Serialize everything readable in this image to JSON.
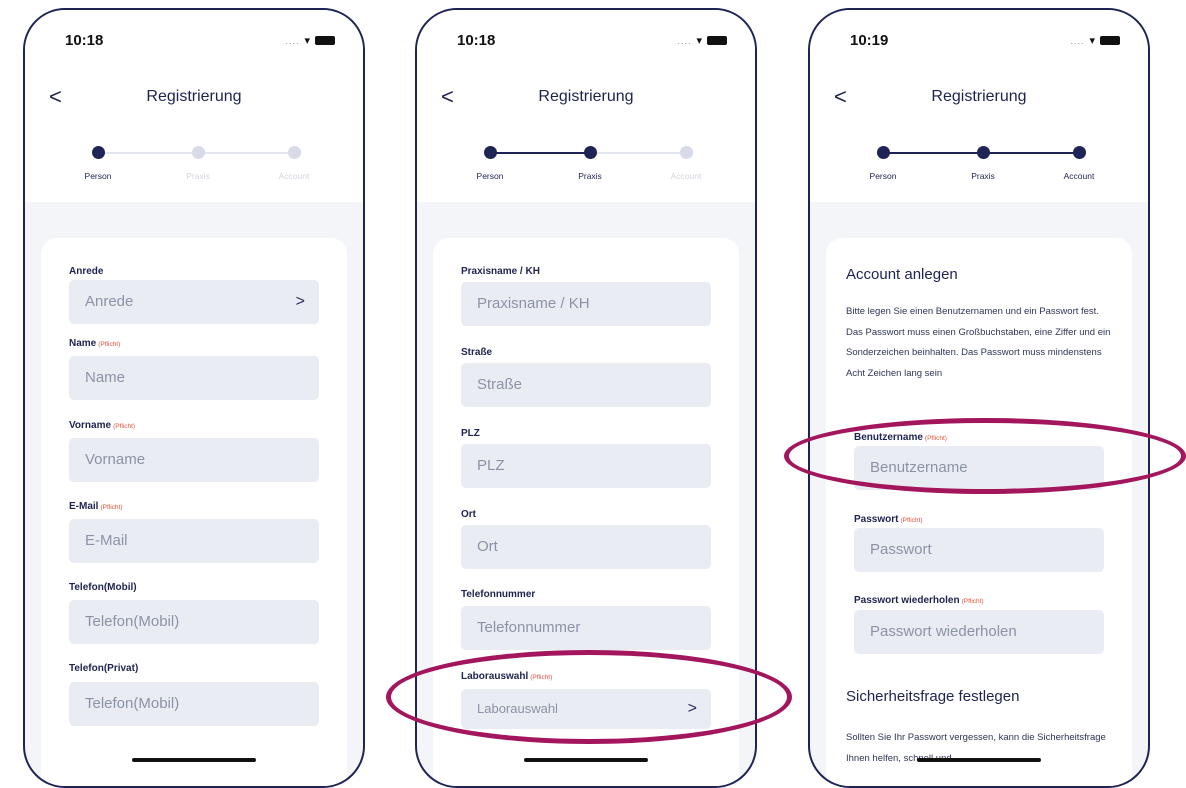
{
  "colors": {
    "primary": "#1f2456",
    "highlight": "#a3155c",
    "required": "#e0533b",
    "input_bg": "#e9ecf3"
  },
  "status": {
    "dots": "....",
    "wifi_icon": "wifi-icon",
    "battery_icon": "battery-icon"
  },
  "screens": [
    {
      "time": "10:18",
      "title": "Registrierung",
      "back": "<",
      "steps": [
        {
          "label": "Person",
          "state": "active"
        },
        {
          "label": "Praxis",
          "state": "inactive"
        },
        {
          "label": "Account",
          "state": "inactive"
        }
      ],
      "fields": [
        {
          "label": "Anrede",
          "required": "",
          "placeholder": "Anrede",
          "chevron": ">"
        },
        {
          "label": "Name",
          "required": "(Pflicht)",
          "placeholder": "Name"
        },
        {
          "label": "Vorname",
          "required": "(Pflicht)",
          "placeholder": "Vorname"
        },
        {
          "label": "E-Mail",
          "required": "(Pflicht)",
          "placeholder": "E-Mail"
        },
        {
          "label": "Telefon(Mobil)",
          "required": "",
          "placeholder": "Telefon(Mobil)"
        },
        {
          "label": "Telefon(Privat)",
          "required": "",
          "placeholder": "Telefon(Mobil)"
        }
      ]
    },
    {
      "time": "10:18",
      "title": "Registrierung",
      "back": "<",
      "steps": [
        {
          "label": "Person",
          "state": "active"
        },
        {
          "label": "Praxis",
          "state": "active"
        },
        {
          "label": "Account",
          "state": "inactive"
        }
      ],
      "fields": [
        {
          "label": "Praxisname / KH",
          "required": "",
          "placeholder": "Praxisname / KH"
        },
        {
          "label": "Straße",
          "required": "",
          "placeholder": "Straße"
        },
        {
          "label": "PLZ",
          "required": "",
          "placeholder": "PLZ"
        },
        {
          "label": "Ort",
          "required": "",
          "placeholder": "Ort"
        },
        {
          "label": "Telefonnummer",
          "required": "",
          "placeholder": "Telefonnummer"
        },
        {
          "label": "Laborauswahl",
          "required": "(Pflicht)",
          "placeholder": "Laborauswahl",
          "chevron": ">"
        }
      ]
    },
    {
      "time": "10:19",
      "title": "Registrierung",
      "back": "<",
      "steps": [
        {
          "label": "Person",
          "state": "active"
        },
        {
          "label": "Praxis",
          "state": "active"
        },
        {
          "label": "Account",
          "state": "active"
        }
      ],
      "section_title": "Account anlegen",
      "description": "Bitte legen Sie einen Benutzernamen und ein Passwort fest. Das Passwort muss einen Großbuchstaben, eine Ziffer und ein Sonderzeichen beinhalten. Das Passwort muss mindenstens Acht Zeichen lang sein",
      "fields": [
        {
          "label": "Benutzername",
          "required": "(Pflicht)",
          "placeholder": "Benutzername"
        },
        {
          "label": "Passwort",
          "required": "(Pflicht)",
          "placeholder": "Passwort"
        },
        {
          "label": "Passwort wiederholen",
          "required": "(Pflicht)",
          "placeholder": "Passwort wiederholen"
        }
      ],
      "section2_title": "Sicherheitsfrage festlegen",
      "description2": "Sollten Sie Ihr Passwort vergessen, kann die Sicherheitsfrage Ihnen helfen, schnell und"
    }
  ]
}
